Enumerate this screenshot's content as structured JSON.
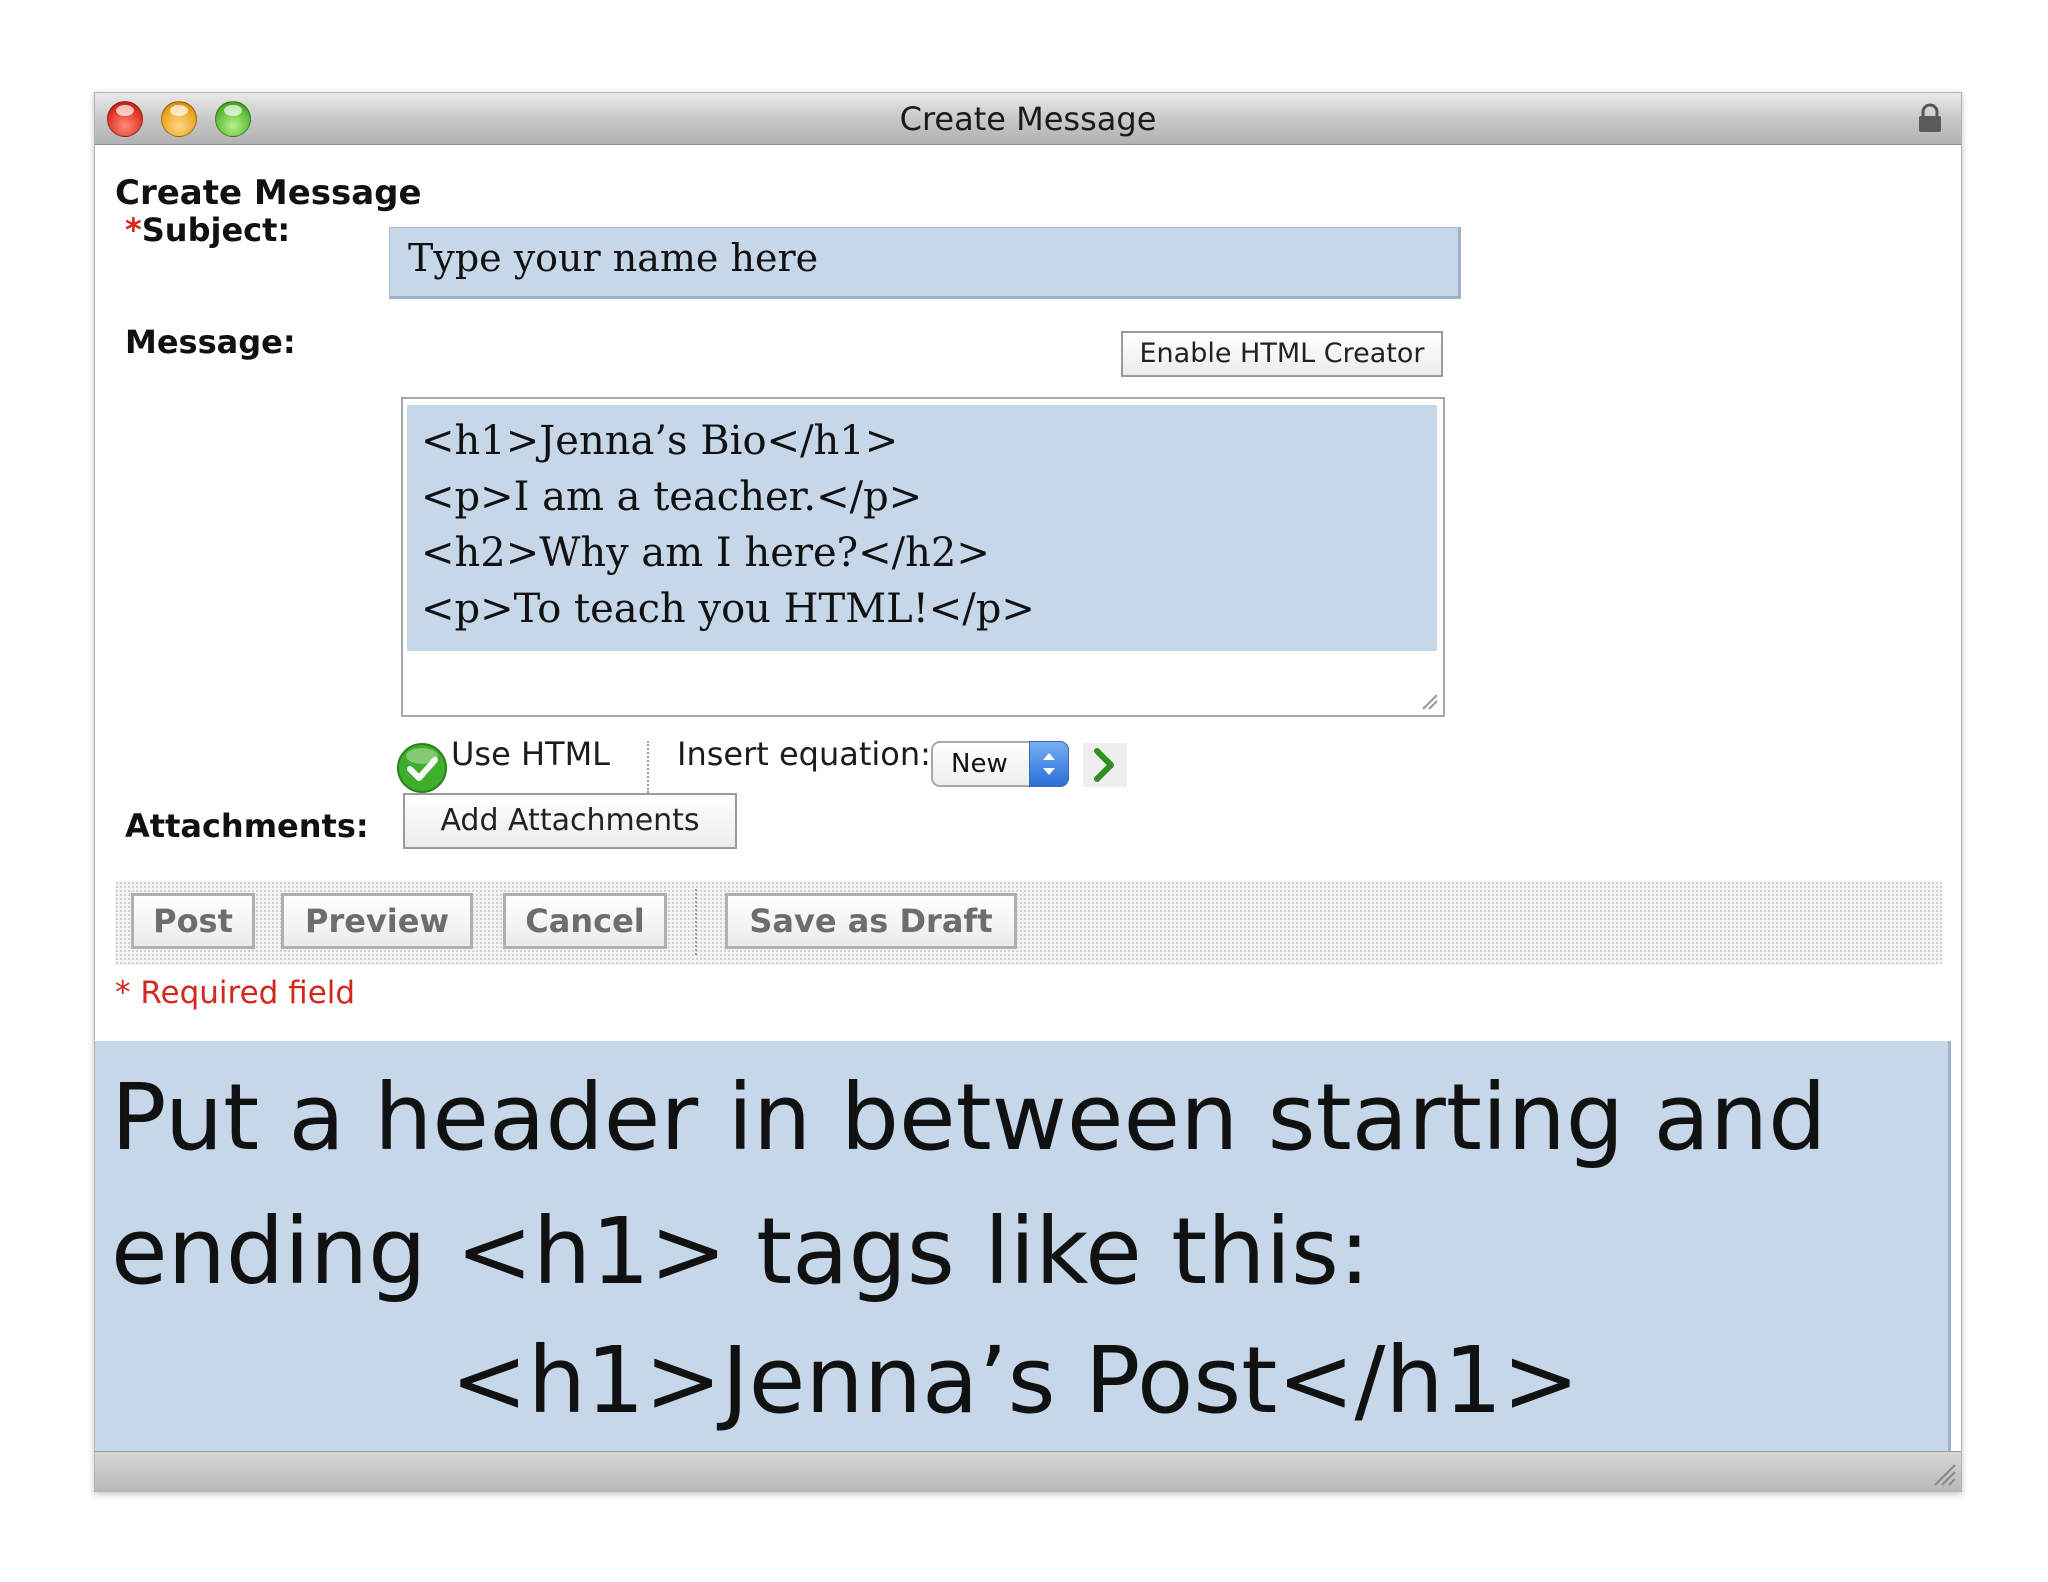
{
  "window": {
    "title": "Create Message"
  },
  "form": {
    "heading": "Create Message",
    "subject": {
      "required_mark": "*",
      "label": "Subject:",
      "value": "Type your name here"
    },
    "message": {
      "label": "Message:",
      "enable_html_creator_label": "Enable HTML Creator",
      "body": "<h1>Jenna’s Bio</h1>\n<p>I am a teacher.</p>\n<h2>Why am I here?</h2>\n<p>To teach you HTML!</p>"
    },
    "options": {
      "use_html_label": "Use HTML",
      "use_html_checked": true,
      "insert_equation_label": "Insert equation:",
      "equation_selected": "New"
    },
    "attachments": {
      "label": "Attachments:",
      "button_label": "Add Attachments"
    },
    "actions": {
      "post": "Post",
      "preview": "Preview",
      "cancel": "Cancel",
      "save_as_draft": "Save as Draft"
    },
    "required_note": "* Required field"
  },
  "instruction": {
    "line": "Put a header in between starting and ending <h1> tags like this:",
    "example": "<h1>Jenna’s Post</h1>"
  },
  "colors": {
    "highlight": "#c7d7ea",
    "required": "#d4281e",
    "check_green": "#3fae2a"
  }
}
